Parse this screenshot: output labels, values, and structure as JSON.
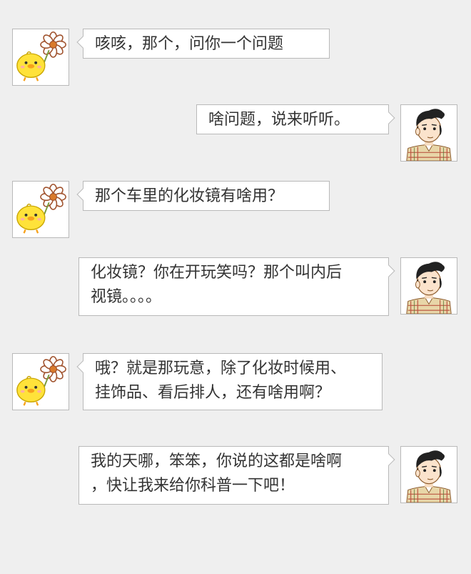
{
  "colors": {
    "background": "#efefef",
    "bubble_bg": "#ffffff",
    "bubble_border": "#b9b9b9",
    "text": "#333333"
  },
  "messages": [
    {
      "sender": "chick",
      "avatar_icon": "chick-with-flower-icon",
      "lines": [
        "咳咳，那个，问你一个问题"
      ]
    },
    {
      "sender": "boy",
      "avatar_icon": "cartoon-boy-icon",
      "lines": [
        "啥问题，说来听听。"
      ]
    },
    {
      "sender": "chick",
      "avatar_icon": "chick-with-flower-icon",
      "lines": [
        "那个车里的化妆镜有啥用？"
      ]
    },
    {
      "sender": "boy",
      "avatar_icon": "cartoon-boy-icon",
      "lines": [
        "化妆镜？你在开玩笑吗？那个叫内后",
        "视镜。。。。"
      ]
    },
    {
      "sender": "chick",
      "avatar_icon": "chick-with-flower-icon",
      "lines": [
        "哦？就是那玩意，除了化妆时候用、",
        "挂饰品、看后排人，还有啥用啊？"
      ]
    },
    {
      "sender": "boy",
      "avatar_icon": "cartoon-boy-icon",
      "lines": [
        "我的天哪，笨笨，你说的这都是啥啊",
        "，快让我来给你科普一下吧！"
      ]
    }
  ]
}
